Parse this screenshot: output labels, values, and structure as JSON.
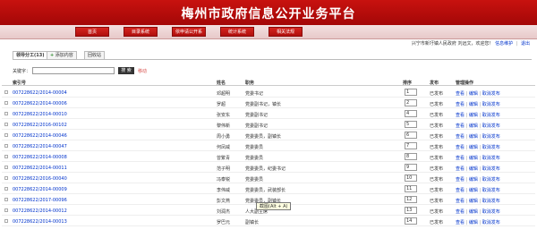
{
  "header": {
    "title": "梅州市政府信息公开业务平台"
  },
  "nav": [
    "首页",
    "目录系统",
    "依申请公开系",
    "统计系统",
    "相关法规"
  ],
  "user": {
    "greeting": "兴宁市新圩镇人民政府 刘远文，欢迎您！",
    "info_link": "信息维护",
    "logout": "退出"
  },
  "tabs": [
    "领导分工(13)",
    "添加内容",
    "回收站"
  ],
  "search": {
    "label": "关键字：",
    "button": "搜 索",
    "move": "移动"
  },
  "columns": [
    "索引号",
    "姓名",
    "职务",
    "排序",
    "发布",
    "管理操作"
  ],
  "rows": [
    {
      "index": "007228622/2014-00004",
      "name": "邓超明",
      "title": "党委书记",
      "order": "1",
      "status": "已发布"
    },
    {
      "index": "007228622/2014-00006",
      "name": "罗超",
      "title": "党委副书记，镇长",
      "order": "2",
      "status": "已发布"
    },
    {
      "index": "007228622/2014-00010",
      "name": "张安东",
      "title": "党委副书记",
      "order": "4",
      "status": "已发布"
    },
    {
      "index": "007228622/2016-00102",
      "name": "黎伟新",
      "title": "党委副书记",
      "order": "5",
      "status": "已发布"
    },
    {
      "index": "007228622/2014-00046",
      "name": "周小勇",
      "title": "党委委员，副镇长",
      "order": "6",
      "status": "已发布"
    },
    {
      "index": "007228622/2014-00047",
      "name": "何凤威",
      "title": "党委委员",
      "order": "7",
      "status": "已发布"
    },
    {
      "index": "007228622/2014-00008",
      "name": "曾繁青",
      "title": "党委委员",
      "order": "8",
      "status": "已发布"
    },
    {
      "index": "007228622/2014-00011",
      "name": "范子明",
      "title": "党委委员，纪委书记",
      "order": "9",
      "status": "已发布"
    },
    {
      "index": "007228622/2016-00040",
      "name": "冯泰锐",
      "title": "党委委员",
      "order": "10",
      "status": "已发布"
    },
    {
      "index": "007228622/2014-00009",
      "name": "李伟威",
      "title": "党委委员，武装部长",
      "order": "11",
      "status": "已发布"
    },
    {
      "index": "007228622/2017-00096",
      "name": "彭文燕",
      "title": "党委委员，副镇长",
      "order": "12",
      "status": "已发布"
    },
    {
      "index": "007228622/2014-00012",
      "name": "刘润杰",
      "title": "人大副主席",
      "order": "13",
      "status": "已发布"
    },
    {
      "index": "007228622/2014-00013",
      "name": "罗巴元",
      "title": "副镇长",
      "order": "14",
      "status": "已发布"
    }
  ],
  "actions": [
    "查看",
    "编辑",
    "取消发布"
  ],
  "tooltip": "截图(Alt + A)"
}
